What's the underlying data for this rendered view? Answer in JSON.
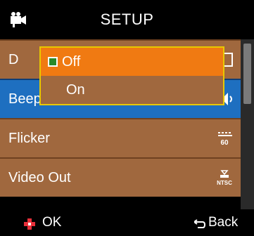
{
  "header": {
    "title": "SETUP",
    "icon": "camcorder-icon"
  },
  "menu": {
    "items": [
      {
        "label": "D",
        "icon": "date-icon"
      },
      {
        "label": "Beep",
        "icon": "beep-icon",
        "selected": true
      },
      {
        "label": "Flicker",
        "icon": "flicker-60hz-icon",
        "icon_text": "60"
      },
      {
        "label": "Video Out",
        "icon": "ntsc-icon",
        "icon_text": "NTSC"
      }
    ]
  },
  "popup": {
    "options": [
      {
        "label": "Off",
        "selected": true
      },
      {
        "label": "On",
        "selected": false
      }
    ]
  },
  "footer": {
    "ok_label": "OK",
    "back_label": "Back"
  },
  "colors": {
    "row": "#a0683e",
    "row_selected": "#1e6fc0",
    "popup_selected": "#f07a12",
    "popup_border": "#e8c800"
  }
}
